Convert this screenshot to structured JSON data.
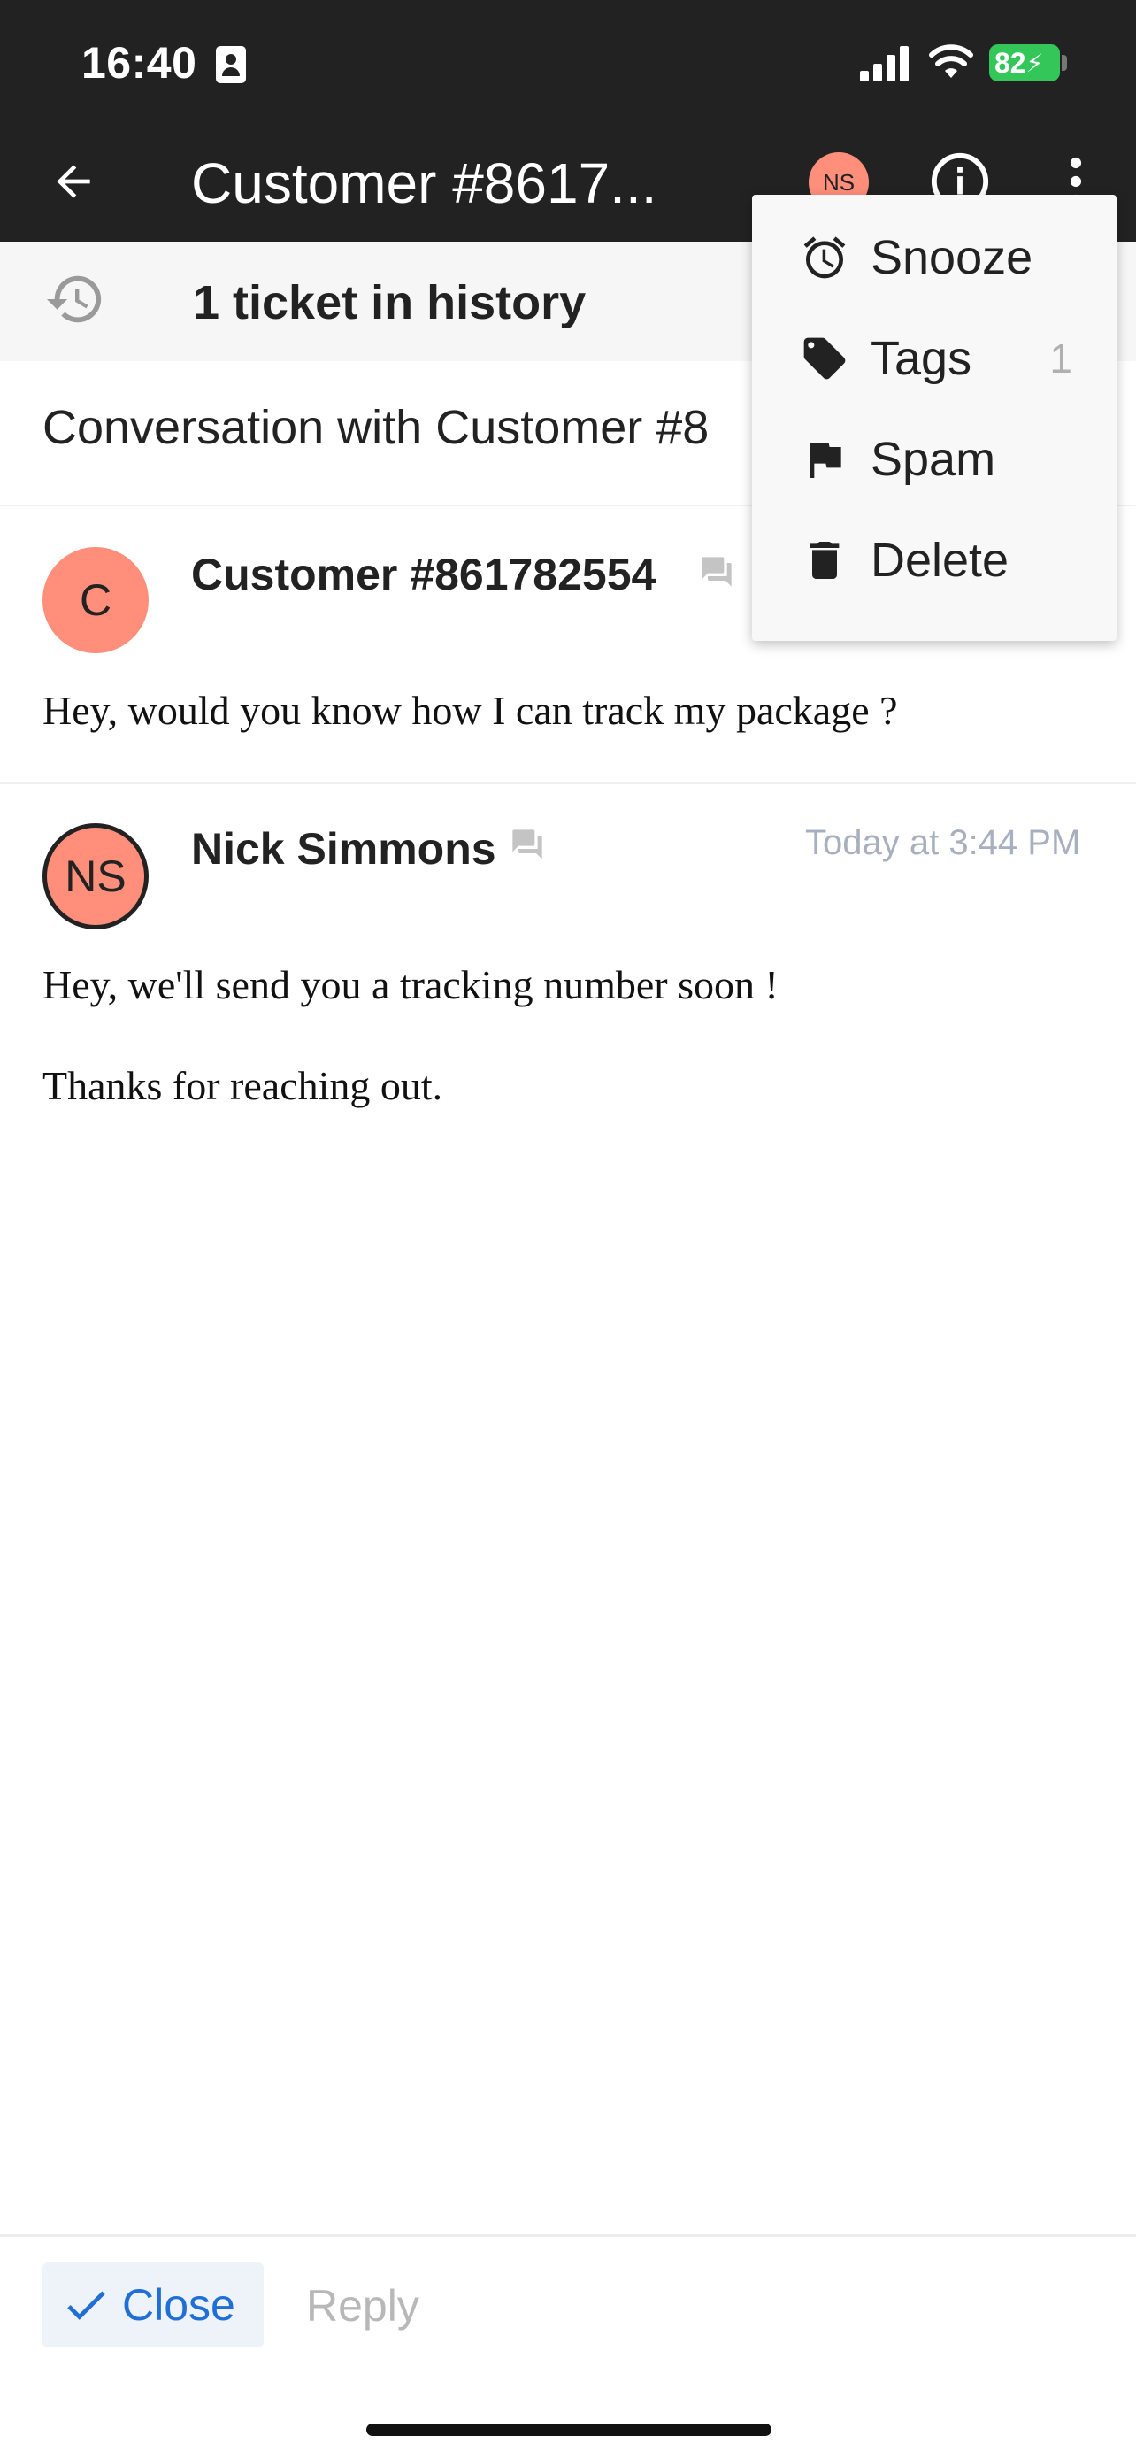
{
  "status_bar": {
    "time": "16:40",
    "battery": "82"
  },
  "app_bar": {
    "title": "Customer #8617...",
    "avatar_initials": "NS"
  },
  "history": {
    "label": "1 ticket in history"
  },
  "conversation": {
    "title": "Conversation with Customer #8"
  },
  "messages": [
    {
      "sender": "Customer #861782554",
      "initials": "C",
      "timestamp": "",
      "lines": [
        "Hey, would you know how I can track my package ?"
      ]
    },
    {
      "sender": "Nick Simmons",
      "initials": "NS",
      "timestamp": "Today at 3:44 PM",
      "lines": [
        "Hey, we'll send you a tracking number soon !",
        "Thanks for reaching out."
      ]
    }
  ],
  "menu": {
    "items": [
      {
        "label": "Snooze",
        "icon": "alarm-icon",
        "count": ""
      },
      {
        "label": "Tags",
        "icon": "tag-icon",
        "count": "1"
      },
      {
        "label": "Spam",
        "icon": "flag-icon",
        "count": ""
      },
      {
        "label": "Delete",
        "icon": "trash-icon",
        "count": ""
      }
    ]
  },
  "actions": {
    "close_label": "Close",
    "reply_label": "Reply"
  },
  "colors": {
    "topbar": "#222222",
    "avatar": "#ff8f7a",
    "accent": "#1f6fd6",
    "battery": "#33c75a"
  }
}
